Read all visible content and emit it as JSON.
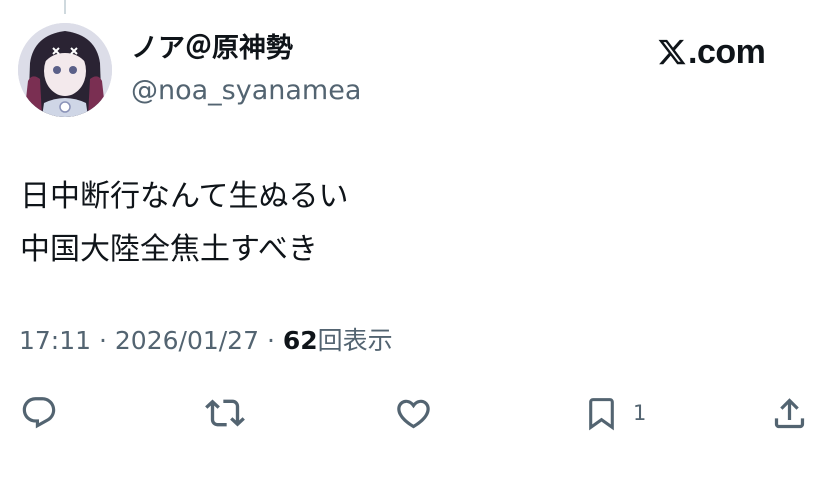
{
  "post": {
    "author": {
      "display_name": "ノア＠原神勢",
      "handle": "@noa_syanamea",
      "avatar": "anime-character-avatar"
    },
    "brand": {
      "text": ".com",
      "icon": "x-logo-icon"
    },
    "text_lines": [
      "日中断行なんて生ぬるい",
      "中国大陸全焦土すべき"
    ],
    "meta": {
      "time": "17:11",
      "separator": "·",
      "date": "2026/01/27",
      "views_count": "62",
      "views_label": "回表示"
    },
    "actions": {
      "reply": {
        "icon": "reply-icon"
      },
      "repost": {
        "icon": "repost-icon"
      },
      "like": {
        "icon": "heart-icon"
      },
      "bookmark": {
        "icon": "bookmark-icon",
        "count": "1"
      },
      "share": {
        "icon": "share-icon"
      }
    }
  },
  "colors": {
    "text_primary": "#0f1419",
    "text_secondary": "#536471",
    "thread_line": "#cfd9de",
    "background": "#ffffff"
  }
}
